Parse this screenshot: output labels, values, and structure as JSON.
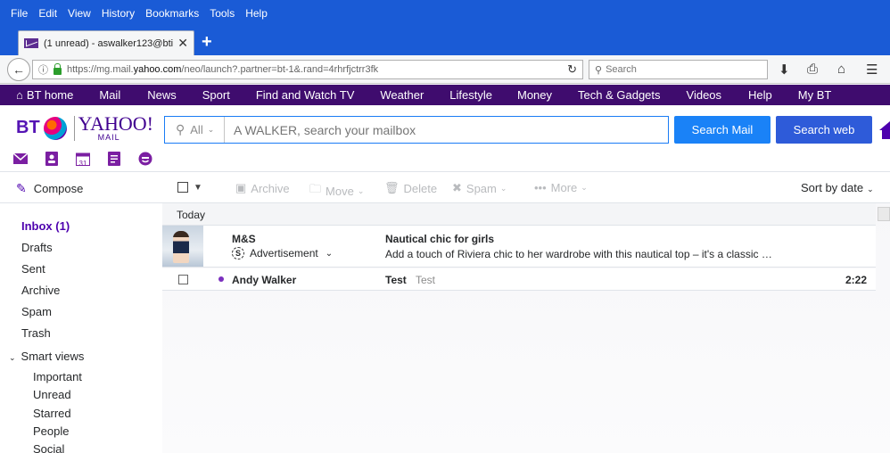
{
  "menubar": {
    "items": [
      "File",
      "Edit",
      "View",
      "History",
      "Bookmarks",
      "Tools",
      "Help"
    ]
  },
  "tab": {
    "title": "(1 unread) - aswalker123@bti...",
    "close": "✕",
    "new": "+"
  },
  "nav": {
    "url_prefix": "https://mg.mail.",
    "url_domain": "yahoo.com",
    "url_suffix": "/neo/launch?.partner=bt-1&.rand=4rhrfjctrr3fk",
    "search_placeholder": "Search"
  },
  "btnav": {
    "items": [
      "BT home",
      "Mail",
      "News",
      "Sport",
      "Find and Watch TV",
      "Weather",
      "Lifestyle",
      "Money",
      "Tech & Gadgets",
      "Videos",
      "Help",
      "My BT"
    ]
  },
  "header": {
    "logo_bt": "BT",
    "logo_yahoo": "YAHOO!",
    "logo_mail": "MAIL",
    "scope": "All",
    "search_placeholder": "A WALKER, search your mailbox",
    "search_mail": "Search Mail",
    "search_web": "Search web",
    "calendar_day": "31"
  },
  "toolbar": {
    "compose": "Compose",
    "archive": "Archive",
    "move": "Move",
    "delete": "Delete",
    "spam": "Spam",
    "more": "More",
    "sort": "Sort by date"
  },
  "sidebar": {
    "inbox": "Inbox (1)",
    "drafts": "Drafts",
    "sent": "Sent",
    "archive": "Archive",
    "spam": "Spam",
    "trash": "Trash",
    "smart_views": "Smart views",
    "important": "Important",
    "unread": "Unread",
    "starred": "Starred",
    "people": "People",
    "social": "Social"
  },
  "list": {
    "group": "Today",
    "ad": {
      "sender": "M&S",
      "tag": "Advertisement",
      "sponsor_glyph": "S",
      "subject": "Nautical chic for girls",
      "preview": "Add a touch of Riviera chic to her wardrobe with this nautical top – it's a classic …"
    },
    "message": {
      "sender": "Andy Walker",
      "subject": "Test",
      "snippet": "Test",
      "time": "2:22"
    }
  },
  "colors": {
    "accent": "#4d00ae",
    "btnav_bg": "#3f0c6e",
    "search_mail_btn": "#1a82f7",
    "search_web_btn": "#2e5bd9",
    "firefox_chrome": "#1a5bd6"
  }
}
